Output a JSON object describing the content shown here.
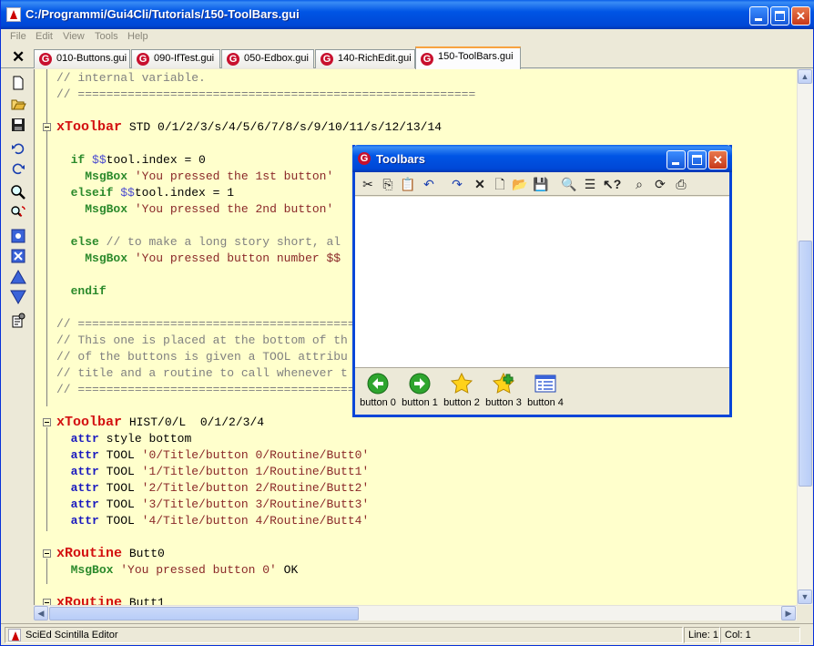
{
  "window": {
    "title": "C:/Programmi/Gui4Cli/Tutorials/150-ToolBars.gui"
  },
  "menu": [
    "File",
    "Edit",
    "View",
    "Tools",
    "Help"
  ],
  "tabs": [
    {
      "label": "010-Buttons.gui"
    },
    {
      "label": "090-IfTest.gui"
    },
    {
      "label": "050-Edbox.gui"
    },
    {
      "label": "140-RichEdit.gui"
    },
    {
      "label": "150-ToolBars.gui",
      "active": true
    }
  ],
  "code": [
    "// internal variable.",
    "// ========================================================",
    "",
    "xToolbar STD 0/1/2/3/s/4/5/6/7/8/s/9/10/11/s/12/13/14",
    "",
    "  if $$tool.index = 0",
    "    MsgBox 'You pressed the 1st button'",
    "  elseif $$tool.index = 1",
    "    MsgBox 'You pressed the 2nd button'",
    "",
    "  else // to make a long story short, al",
    "    MsgBox 'You pressed button number $$",
    "",
    "  endif",
    "",
    "// ===========================================",
    "// This one is placed at the bottom of th",
    "// of the buttons is given a TOOL attribu",
    "// title and a routine to call whenever t",
    "// ===========================================",
    "",
    "xToolbar HIST/0/L  0/1/2/3/4",
    "  attr style bottom",
    "  attr TOOL '0/Title/button 0/Routine/Butt0'",
    "  attr TOOL '1/Title/button 1/Routine/Butt1'",
    "  attr TOOL '2/Title/button 2/Routine/Butt2'",
    "  attr TOOL '3/Title/button 3/Routine/Butt3'",
    "  attr TOOL '4/Title/button 4/Routine/Butt4'",
    "",
    "xRoutine Butt0",
    "  MsgBox 'You pressed button 0' OK",
    "",
    "xRoutine Butt1"
  ],
  "status": {
    "app": "SciEd Scintilla Editor",
    "line": "Line: 1",
    "col": "Col: 1"
  },
  "dialog": {
    "title": "Toolbars",
    "buttons": [
      "button 0",
      "button 1",
      "button 2",
      "button 3",
      "button 4"
    ]
  }
}
